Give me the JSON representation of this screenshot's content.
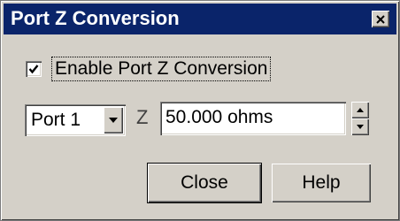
{
  "dialog": {
    "title": "Port Z Conversion",
    "close_icon": "close-x-icon"
  },
  "enable_checkbox": {
    "label": "Enable Port Z Conversion",
    "checked": true
  },
  "port_select": {
    "selected": "Port 1",
    "arrow_icon": "dropdown-arrow-icon"
  },
  "impedance": {
    "symbol": "Z",
    "value": "50.000 ohms",
    "spin_up_icon": "spin-up-icon",
    "spin_down_icon": "spin-down-icon"
  },
  "buttons": {
    "close_label": "Close",
    "help_label": "Help"
  },
  "colors": {
    "titlebar": "#0a246a",
    "dialog_bg": "#d4d0c8"
  }
}
